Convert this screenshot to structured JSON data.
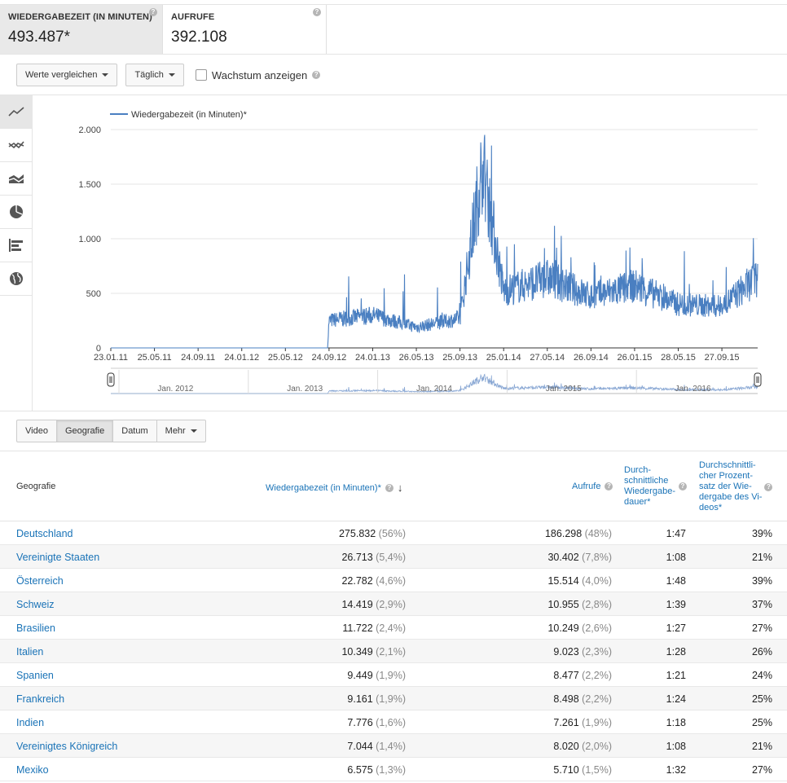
{
  "metrics": [
    {
      "label": "WIEDERGABEZEIT (IN MINUTEN)",
      "value": "493.487*"
    },
    {
      "label": "AUFRUFE",
      "value": "392.108"
    }
  ],
  "toolbar": {
    "compare_label": "Werte vergleichen",
    "interval_label": "Täglich",
    "growth_label": "Wachstum anzeigen"
  },
  "chart_view_icons": [
    "line-chart-icon",
    "multi-line-chart-icon",
    "stacked-area-icon",
    "pie-chart-icon",
    "bar-chart-icon",
    "globe-map-icon"
  ],
  "chart_data": {
    "type": "line",
    "series": [
      {
        "name": "Wiedergabezeit (in Minuten)*",
        "color": "#4a7fc1"
      }
    ],
    "y_ticks": [
      "0",
      "500",
      "1.000",
      "1.500",
      "2.000"
    ],
    "ylim": [
      0,
      2000
    ],
    "x_ticks": [
      "23.01.11",
      "25.05.11",
      "24.09.11",
      "24.01.12",
      "25.05.12",
      "24.09.12",
      "24.01.13",
      "26.05.13",
      "25.09.13",
      "25.01.14",
      "27.05.14",
      "26.09.14",
      "26.01.15",
      "28.05.15",
      "27.09.15"
    ],
    "key_points": [
      {
        "x": "23.01.11",
        "y": 0
      },
      {
        "x": "20.09.12",
        "y": 0
      },
      {
        "x": "24.09.12",
        "y": 250
      },
      {
        "x": "24.01.13",
        "y": 300
      },
      {
        "x": "26.05.13",
        "y": 190
      },
      {
        "x": "25.09.13",
        "y": 270
      },
      {
        "x": "27.11.13",
        "y": 1680
      },
      {
        "x": "25.01.14",
        "y": 520
      },
      {
        "x": "27.05.14",
        "y": 640
      },
      {
        "x": "26.09.14",
        "y": 470
      },
      {
        "x": "26.01.15",
        "y": 570
      },
      {
        "x": "28.05.15",
        "y": 400
      },
      {
        "x": "27.09.15",
        "y": 380
      },
      {
        "x": "05.01.16",
        "y": 650
      }
    ],
    "navigator_labels": [
      "Jan. 2012",
      "Jan. 2013",
      "Jan. 2014",
      "Jan. 2015",
      "Jan. 2016"
    ],
    "grid": true,
    "legend": "top-left"
  },
  "tabs": [
    "Video",
    "Geografie",
    "Datum",
    "Mehr"
  ],
  "table": {
    "headers": {
      "geo": "Geografie",
      "watch": "Wiedergabezeit (in Minuten)*",
      "views": "Aufrufe",
      "avg_dur_1": "Durch-",
      "avg_dur_2": "schnittliche",
      "avg_dur_3": "Wiedergabe-",
      "avg_dur_4": "dauer*",
      "avg_pct_1": "Durchschnittli-",
      "avg_pct_2": "cher Prozent-",
      "avg_pct_3": "satz der Wie-",
      "avg_pct_4": "dergabe des Vi-",
      "avg_pct_5": "deos*"
    },
    "rows": [
      {
        "country": "Deutschland",
        "watch": "275.832",
        "watch_pct": "(56%)",
        "views": "186.298",
        "views_pct": "(48%)",
        "avg": "1:47",
        "pct": "39%"
      },
      {
        "country": "Vereinigte Staaten",
        "watch": "26.713",
        "watch_pct": "(5,4%)",
        "views": "30.402",
        "views_pct": "(7,8%)",
        "avg": "1:08",
        "pct": "21%"
      },
      {
        "country": "Österreich",
        "watch": "22.782",
        "watch_pct": "(4,6%)",
        "views": "15.514",
        "views_pct": "(4,0%)",
        "avg": "1:48",
        "pct": "39%"
      },
      {
        "country": "Schweiz",
        "watch": "14.419",
        "watch_pct": "(2,9%)",
        "views": "10.955",
        "views_pct": "(2,8%)",
        "avg": "1:39",
        "pct": "37%"
      },
      {
        "country": "Brasilien",
        "watch": "11.722",
        "watch_pct": "(2,4%)",
        "views": "10.249",
        "views_pct": "(2,6%)",
        "avg": "1:27",
        "pct": "27%"
      },
      {
        "country": "Italien",
        "watch": "10.349",
        "watch_pct": "(2,1%)",
        "views": "9.023",
        "views_pct": "(2,3%)",
        "avg": "1:28",
        "pct": "26%"
      },
      {
        "country": "Spanien",
        "watch": "9.449",
        "watch_pct": "(1,9%)",
        "views": "8.477",
        "views_pct": "(2,2%)",
        "avg": "1:21",
        "pct": "24%"
      },
      {
        "country": "Frankreich",
        "watch": "9.161",
        "watch_pct": "(1,9%)",
        "views": "8.498",
        "views_pct": "(2,2%)",
        "avg": "1:24",
        "pct": "25%"
      },
      {
        "country": "Indien",
        "watch": "7.776",
        "watch_pct": "(1,6%)",
        "views": "7.261",
        "views_pct": "(1,9%)",
        "avg": "1:18",
        "pct": "25%"
      },
      {
        "country": "Vereinigtes Königreich",
        "watch": "7.044",
        "watch_pct": "(1,4%)",
        "views": "8.020",
        "views_pct": "(2,0%)",
        "avg": "1:08",
        "pct": "21%"
      },
      {
        "country": "Mexiko",
        "watch": "6.575",
        "watch_pct": "(1,3%)",
        "views": "5.710",
        "views_pct": "(1,5%)",
        "avg": "1:32",
        "pct": "27%"
      }
    ]
  }
}
